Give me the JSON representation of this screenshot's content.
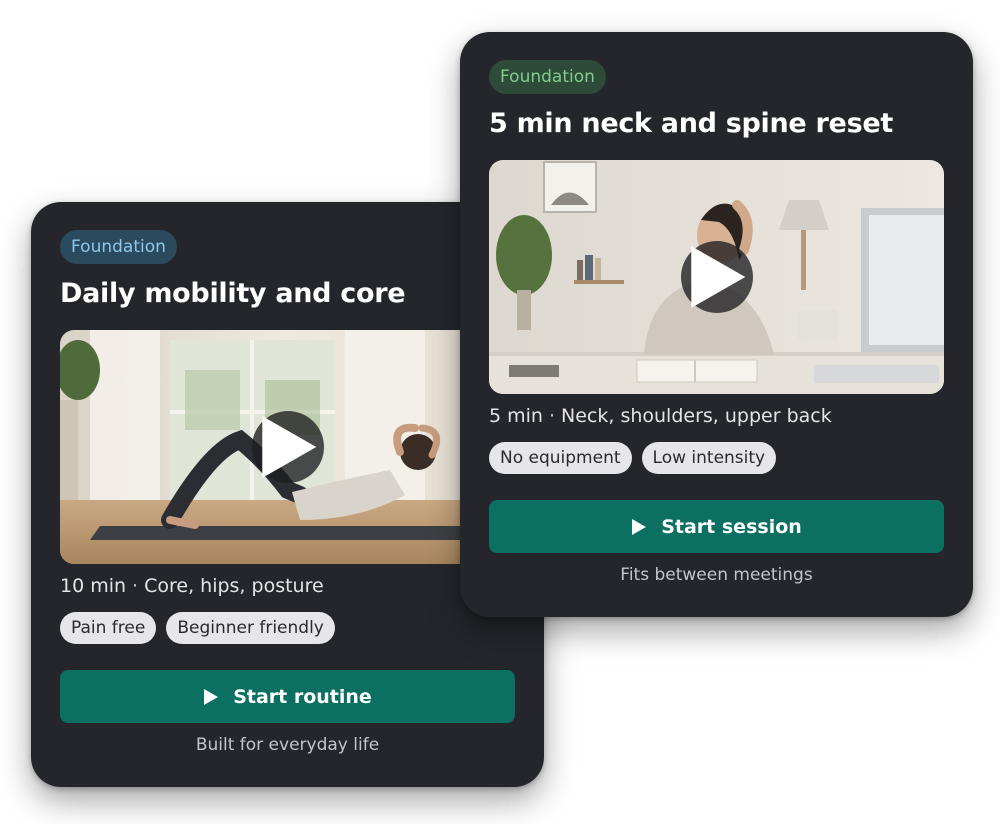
{
  "cards": [
    {
      "badge": "Foundation",
      "title": "Daily mobility and core",
      "duration": "10 min",
      "focus": "Core, hips, posture",
      "tags": [
        "Pain free",
        "Beginner friendly"
      ],
      "cta": "Start routine",
      "caption": "Built for everyday life",
      "badge_color": "#8cc8ec",
      "button_color": "#0b6f61",
      "image_icon": "person-crunch-on-mat"
    },
    {
      "badge": "Foundation",
      "title": "5 min neck and spine reset",
      "duration": "5 min",
      "focus": "Neck, shoulders, upper back",
      "tags": [
        "No equipment",
        "Low intensity"
      ],
      "cta": "Start session",
      "caption": "Fits between meetings",
      "badge_color": "#80cc8c",
      "button_color": "#0b6f61",
      "image_icon": "person-neck-stretch-at-desk"
    }
  ],
  "separator": "·",
  "play_icon": "play-icon"
}
